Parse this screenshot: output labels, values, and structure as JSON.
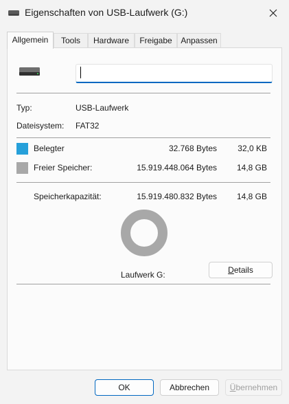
{
  "window": {
    "title": "Eigenschaften von USB-Laufwerk (G:)",
    "title_icon": "usb-drive-icon",
    "close_icon": "close-icon"
  },
  "tabs": [
    {
      "label": "Allgemein",
      "active": true
    },
    {
      "label": "Tools"
    },
    {
      "label": "Hardware"
    },
    {
      "label": "Freigabe"
    },
    {
      "label": "Anpassen"
    }
  ],
  "general": {
    "drive_icon": "usb-drive-icon",
    "name_value": "",
    "type_label": "Typ:",
    "type_value": "USB-Laufwerk",
    "fs_label": "Dateisystem:",
    "fs_value": "FAT32",
    "used": {
      "label": "Belegter",
      "bytes": "32.768 Bytes",
      "size": "32,0 KB",
      "color": "#26a0da"
    },
    "free": {
      "label": "Freier Speicher:",
      "bytes": "15.919.448.064 Bytes",
      "size": "14,8 GB",
      "color": "#a8a8a8"
    },
    "capacity": {
      "label": "Speicherkapazität:",
      "bytes": "15.919.480.832 Bytes",
      "size": "14,8 GB"
    },
    "used_fraction": 2e-06,
    "drive_label": "Laufwerk G:",
    "details_button": {
      "mnemonic": "D",
      "rest": "etails"
    }
  },
  "footer": {
    "ok": "OK",
    "cancel": "Abbrechen",
    "apply": {
      "mnemonic": "Ü",
      "rest": "bernehmen"
    }
  }
}
